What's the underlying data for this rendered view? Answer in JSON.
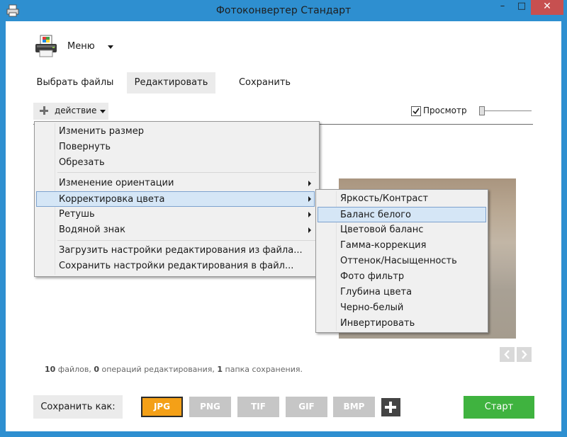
{
  "window": {
    "title": "Фотоконвертер Стандарт",
    "minimize_glyph": "–",
    "maximize_glyph": "□",
    "close_glyph": "✕"
  },
  "menu": {
    "label": "Меню"
  },
  "tabs": [
    {
      "label": "Выбрать файлы",
      "active": false
    },
    {
      "label": "Редактировать",
      "active": true
    },
    {
      "label": "Сохранить",
      "active": false
    }
  ],
  "action": {
    "label": "действие"
  },
  "preview": {
    "label": "Просмотр",
    "checked": true
  },
  "context_menu": {
    "items": [
      {
        "label": "Изменить размер",
        "submenu": false
      },
      {
        "label": "Повернуть",
        "submenu": false
      },
      {
        "label": "Обрезать",
        "submenu": false
      },
      {
        "label": "Изменение ориентации",
        "submenu": true
      },
      {
        "label": "Корректировка цвета",
        "submenu": true,
        "highlighted": true
      },
      {
        "label": "Ретушь",
        "submenu": true
      },
      {
        "label": "Водяной знак",
        "submenu": true
      },
      {
        "label": "Загрузить настройки редактирования из файла...",
        "submenu": false
      },
      {
        "label": "Сохранить настройки редактирования в файл...",
        "submenu": false
      }
    ]
  },
  "color_submenu": {
    "items": [
      {
        "label": "Яркость/Контраст"
      },
      {
        "label": "Баланс белого",
        "highlighted": true
      },
      {
        "label": "Цветовой баланс"
      },
      {
        "label": "Гамма-коррекция"
      },
      {
        "label": "Оттенок/Насыщенность"
      },
      {
        "label": "Фото фильтр"
      },
      {
        "label": "Глубина цвета"
      },
      {
        "label": "Черно-белый"
      },
      {
        "label": "Инвертировать"
      }
    ]
  },
  "status": {
    "files_count": "10",
    "files_text": " файлов, ",
    "ops_count": "0",
    "ops_text": " операций редактирования, ",
    "folders_count": "1",
    "folders_text": " папка сохранения."
  },
  "save_as": {
    "label": "Сохранить как:"
  },
  "formats": [
    {
      "label": "JPG",
      "active": true
    },
    {
      "label": "PNG",
      "active": false
    },
    {
      "label": "TIF",
      "active": false
    },
    {
      "label": "GIF",
      "active": false
    },
    {
      "label": "BMP",
      "active": false
    }
  ],
  "start": {
    "label": "Старт"
  },
  "colors": {
    "title_bar": "#2e8fd0",
    "close_button": "#c75050",
    "active_format": "#f4a017",
    "start_button": "#3fb33f",
    "menu_highlight": "#d5e6f6"
  }
}
